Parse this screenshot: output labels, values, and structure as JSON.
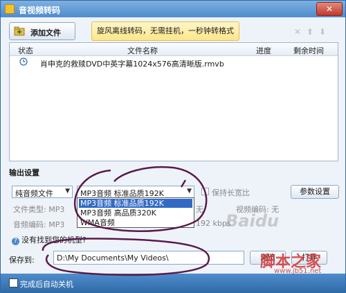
{
  "window": {
    "title": "音视频转码",
    "close": "✕"
  },
  "toolbar": {
    "add_label": "添加文件",
    "promo_text": "旋风离线转码，无需挂机，一秒钟转格式"
  },
  "list": {
    "columns": [
      "状态",
      "文件名称",
      "进度",
      "剩余时间"
    ],
    "rows": [
      {
        "status_icon": "clock-icon",
        "name": "肖申克的救赎DVD中英字幕1024x576高清晰版.rmvb",
        "progress": "",
        "remaining": ""
      }
    ]
  },
  "output": {
    "section_title": "输出设置",
    "format_select": "纯音频文件",
    "quality_select": "MP3音频 标准品质192K",
    "keep_ratio": "保持长宽比",
    "params_button": "参数设置",
    "file_type_label": "文件类型: MP3",
    "audio_codec_label": "音频编码: MP3",
    "video_codec_label": "视频编码: 无",
    "bitrate_partial": "192 kbps",
    "partial_none": "无",
    "dropdown_options": [
      "MP3音频 标准品质192K",
      "MP3音频 高品质320K",
      "WMA音频"
    ],
    "help_text": "没有找到您的机型?"
  },
  "save": {
    "label": "保存到:",
    "path": "D:\\My Documents\\My Videos\\",
    "browse_button": "浏览",
    "open_button": "打开"
  },
  "footer": {
    "shutdown_label": "完成后自动关机"
  },
  "watermark": {
    "line1": "Baidu",
    "line2": "脚本之家",
    "line3": "www.jb51.net"
  },
  "colors": {
    "accent": "#4f8ccc",
    "promo": "#fde68a",
    "selection": "#316ac5",
    "ink": "#5a1a4a"
  }
}
